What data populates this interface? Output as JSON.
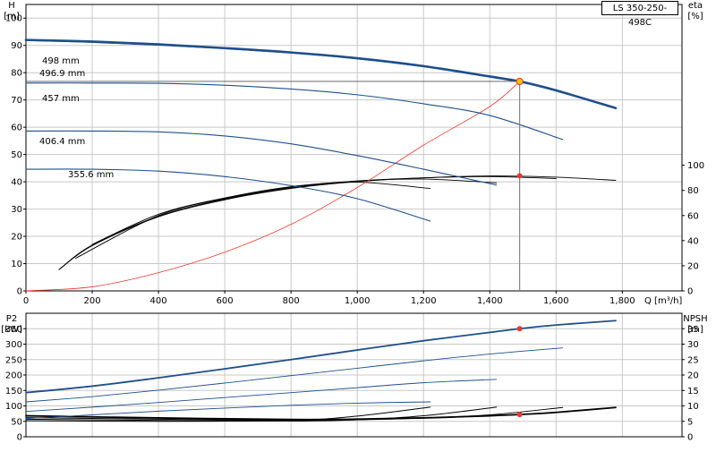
{
  "model": "LS 350-250-498C",
  "colors": {
    "blue": "#1f4f8a",
    "black": "#000000",
    "red": "#e8392f",
    "grid": "#c8c8c8",
    "op_yellow": "#f5c400"
  },
  "chart_data": [
    {
      "id": "top",
      "type": "line",
      "xlabel": "Q [m³/h]",
      "xticks": [
        0,
        200,
        400,
        600,
        800,
        1000,
        1200,
        1400,
        1600,
        1800
      ],
      "xtick_labels": [
        "0",
        "200",
        "400",
        "600",
        "800",
        "1,000",
        "1,200",
        "1,400",
        "1,600",
        "1,800"
      ],
      "xlim": [
        0,
        1980
      ],
      "left_axis": {
        "label_line1": "H",
        "label_line2": "[m]",
        "ylim": [
          0,
          105
        ],
        "ticks": [
          0,
          10,
          20,
          30,
          40,
          50,
          60,
          70,
          80,
          90,
          100
        ]
      },
      "right_axis": {
        "label_line1": "eta",
        "label_line2": "[%]",
        "ylim": [
          0,
          228
        ],
        "ticks": [
          0,
          20,
          40,
          60,
          80,
          100
        ]
      },
      "head_curves": [
        {
          "label": "498 mm",
          "x": [
            0,
            200,
            400,
            600,
            800,
            1000,
            1200,
            1400,
            1490,
            1600,
            1780
          ],
          "y": [
            92,
            91.4,
            90.4,
            89,
            87.4,
            85.3,
            82.4,
            78.6,
            76.8,
            73.5,
            67
          ]
        },
        {
          "label": "496.9 mm",
          "x": [
            0,
            200,
            400,
            600,
            800,
            1000,
            1200,
            1400,
            1490
          ],
          "y": [
            91.8,
            91.1,
            90.1,
            88.8,
            87.2,
            85.1,
            82.2,
            78.4,
            76.6
          ]
        },
        {
          "label": "457 mm",
          "x": [
            0,
            200,
            400,
            600,
            800,
            1000,
            1200,
            1400,
            1620
          ],
          "y": [
            76.2,
            76.2,
            76.1,
            75.4,
            74,
            71.9,
            68.6,
            64.3,
            55.5
          ]
        },
        {
          "label": "406.4 mm",
          "x": [
            0,
            200,
            400,
            600,
            800,
            1000,
            1200,
            1420
          ],
          "y": [
            58.6,
            58.6,
            58.3,
            56.8,
            53.9,
            49.6,
            44.6,
            38.8
          ]
        },
        {
          "label": "355.6 mm",
          "x": [
            0,
            200,
            400,
            600,
            800,
            1000,
            1220
          ],
          "y": [
            44.6,
            44.6,
            43.9,
            41.9,
            38.6,
            33.8,
            25.6
          ]
        }
      ],
      "system_curve": {
        "x": [
          0,
          200,
          400,
          600,
          800,
          1000,
          1200,
          1400,
          1490
        ],
        "y": [
          0,
          1.5,
          6.7,
          14.2,
          24.4,
          37.9,
          53.4,
          67.6,
          76.8
        ]
      },
      "efficiency_curves": [
        {
          "x": [
            100,
            200,
            400,
            600,
            800,
            1000,
            1200,
            1400,
            1600,
            1780
          ],
          "y": [
            17,
            36,
            59,
            72.5,
            81.5,
            87,
            90,
            91.5,
            90.5,
            88
          ]
        },
        {
          "x": [
            100,
            200,
            400,
            600,
            800,
            1000,
            1200,
            1400,
            1600
          ],
          "y": [
            17,
            36.5,
            59.5,
            73,
            82,
            87.5,
            90,
            91,
            89.5
          ]
        },
        {
          "x": [
            150,
            400,
            600,
            800,
            1000,
            1200,
            1420
          ],
          "y": [
            26,
            60,
            73.5,
            82.5,
            87.5,
            89,
            86
          ]
        },
        {
          "x": [
            200,
            400,
            600,
            800,
            1000,
            1220
          ],
          "y": [
            37,
            61,
            74,
            83,
            86.5,
            81.5
          ]
        }
      ],
      "operating_point": {
        "q": 1490,
        "h": 76.8,
        "eta": 91.6
      }
    },
    {
      "id": "bottom",
      "type": "line",
      "xlim": [
        0,
        1980
      ],
      "left_axis": {
        "label_line1": "P2",
        "label_line2": "[kW]",
        "ylim": [
          0,
          400
        ],
        "ticks": [
          0,
          50,
          100,
          150,
          200,
          250,
          300,
          350
        ]
      },
      "right_axis": {
        "label_line1": "NPSH",
        "label_line2": "[m]",
        "ylim": [
          0,
          40
        ],
        "ticks": [
          0,
          5,
          10,
          15,
          20,
          25,
          30,
          35
        ]
      },
      "power_curves": [
        {
          "label": "498 mm",
          "x": [
            0,
            200,
            400,
            600,
            800,
            1000,
            1200,
            1400,
            1490,
            1600,
            1780
          ],
          "y": [
            143,
            164,
            191,
            220,
            250,
            281,
            311,
            338,
            350,
            362,
            376
          ]
        },
        {
          "label": "457 mm",
          "x": [
            0,
            200,
            400,
            600,
            800,
            1000,
            1200,
            1400,
            1620
          ],
          "y": [
            113,
            130,
            151,
            174,
            198,
            222,
            246,
            268,
            288
          ]
        },
        {
          "label": "406.4 mm",
          "x": [
            0,
            200,
            400,
            600,
            800,
            1000,
            1200,
            1420
          ],
          "y": [
            82,
            96,
            111,
            127,
            143,
            159,
            175,
            186
          ]
        },
        {
          "label": "355.6 mm",
          "x": [
            0,
            200,
            400,
            600,
            800,
            1000,
            1220
          ],
          "y": [
            59,
            71,
            83,
            93,
            102,
            109,
            113
          ]
        }
      ],
      "npsh_curves": [
        {
          "x": [
            0,
            400,
            800,
            1000,
            1200,
            1400,
            1490,
            1600,
            1780
          ],
          "y": [
            6.8,
            6.1,
            5.6,
            5.7,
            6.1,
            6.8,
            7.2,
            7.9,
            9.5
          ]
        },
        {
          "x": [
            0,
            400,
            800,
            1000,
            1200,
            1400,
            1620
          ],
          "y": [
            6.2,
            5.7,
            5.3,
            5.5,
            6.1,
            7.1,
            9.5
          ]
        },
        {
          "x": [
            0,
            400,
            800,
            1000,
            1200,
            1420
          ],
          "y": [
            5.7,
            5.3,
            5.1,
            5.5,
            6.8,
            9.6
          ]
        },
        {
          "x": [
            0,
            400,
            800,
            1000,
            1220
          ],
          "y": [
            5.2,
            5.0,
            5.3,
            6.7,
            9.6
          ]
        }
      ],
      "operating_point": {
        "q": 1490,
        "p2": 350,
        "npsh": 7.2
      }
    }
  ]
}
